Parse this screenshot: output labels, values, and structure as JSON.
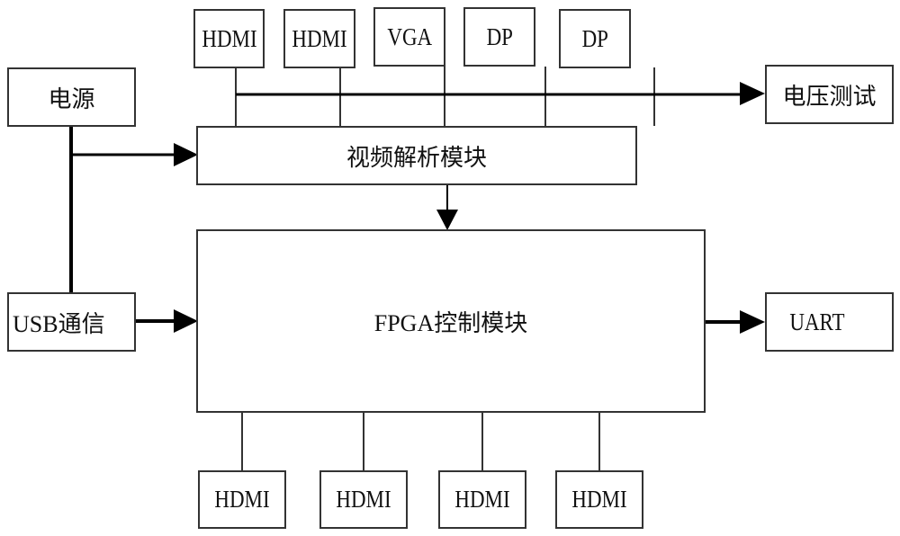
{
  "diagram": {
    "title": "",
    "nodes": {
      "input_hdmi_1": "HDMI",
      "input_hdmi_2": "HDMI",
      "input_vga": "VGA",
      "input_dp_1": "DP",
      "input_dp_2": "DP",
      "power": "电源",
      "voltage_test": "电压测试",
      "video_parse_module": "视频解析模块",
      "fpga_control_module": "FPGA控制模块",
      "usb_comm": "USB通信",
      "uart": "UART",
      "output_hdmi_1": "HDMI",
      "output_hdmi_2": "HDMI",
      "output_hdmi_3": "HDMI",
      "output_hdmi_4": "HDMI"
    },
    "edges": [
      {
        "from": "input_hdmi_1",
        "to": "video_parse_module",
        "arrow": false
      },
      {
        "from": "input_hdmi_2",
        "to": "video_parse_module",
        "arrow": false
      },
      {
        "from": "input_vga",
        "to": "video_parse_module",
        "arrow": false
      },
      {
        "from": "input_dp_1",
        "to": "video_parse_module",
        "arrow": false
      },
      {
        "from": "input_dp_2",
        "to": "video_parse_module",
        "arrow": false
      },
      {
        "from": "input_bus",
        "to": "voltage_test",
        "arrow": true
      },
      {
        "from": "power",
        "to": "video_parse_module",
        "arrow": true
      },
      {
        "from": "power",
        "to": "usb_comm",
        "arrow": false
      },
      {
        "from": "video_parse_module",
        "to": "fpga_control_module",
        "arrow": true
      },
      {
        "from": "usb_comm",
        "to": "fpga_control_module",
        "arrow": true
      },
      {
        "from": "fpga_control_module",
        "to": "uart",
        "arrow": true
      },
      {
        "from": "fpga_control_module",
        "to": "output_hdmi_1",
        "arrow": false
      },
      {
        "from": "fpga_control_module",
        "to": "output_hdmi_2",
        "arrow": false
      },
      {
        "from": "fpga_control_module",
        "to": "output_hdmi_3",
        "arrow": false
      },
      {
        "from": "fpga_control_module",
        "to": "output_hdmi_4",
        "arrow": false
      }
    ]
  }
}
